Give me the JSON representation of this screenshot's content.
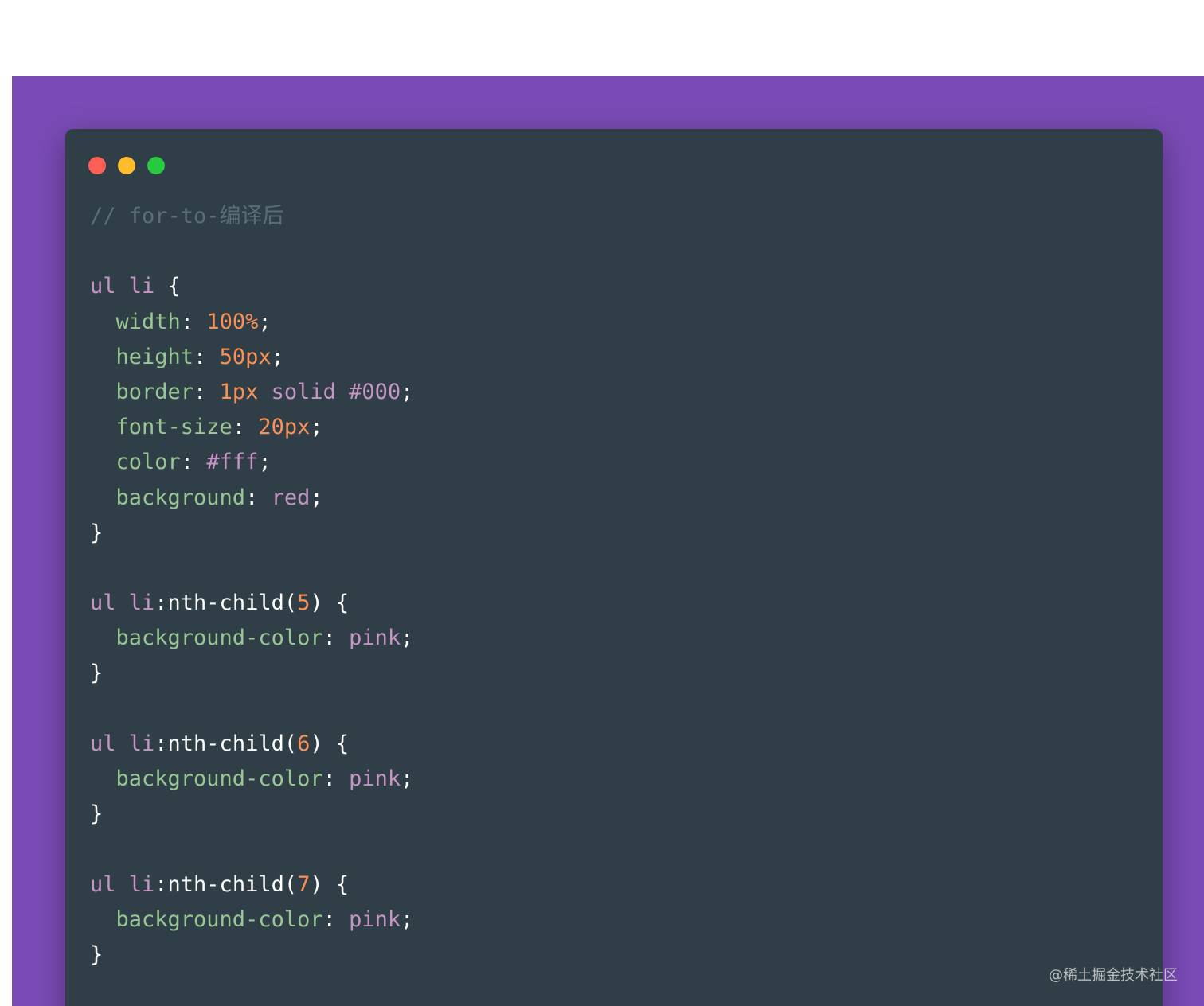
{
  "colors": {
    "background": "#7a4bb6",
    "window": "#2f3e47",
    "comment": "#5d6d75",
    "selector": "#c594c5",
    "property": "#99c794",
    "number": "#f99157",
    "punctuation": "#ffffff"
  },
  "window_controls": [
    {
      "name": "close",
      "color": "#ff5f56"
    },
    {
      "name": "minimize",
      "color": "#ffbd2e"
    },
    {
      "name": "maximize",
      "color": "#27c93f"
    }
  ],
  "code_lines": [
    [
      {
        "t": "// for-to-编译后",
        "c": "comment"
      }
    ],
    [],
    [
      {
        "t": "ul li",
        "c": "selector"
      },
      {
        "t": " {",
        "c": "punct"
      }
    ],
    [
      {
        "t": "  width",
        "c": "property"
      },
      {
        "t": ": ",
        "c": "punct"
      },
      {
        "t": "100%",
        "c": "number"
      },
      {
        "t": ";",
        "c": "punct"
      }
    ],
    [
      {
        "t": "  height",
        "c": "property"
      },
      {
        "t": ": ",
        "c": "punct"
      },
      {
        "t": "50px",
        "c": "number"
      },
      {
        "t": ";",
        "c": "punct"
      }
    ],
    [
      {
        "t": "  border",
        "c": "property"
      },
      {
        "t": ": ",
        "c": "punct"
      },
      {
        "t": "1px",
        "c": "number"
      },
      {
        "t": " solid #000",
        "c": "keyword"
      },
      {
        "t": ";",
        "c": "punct"
      }
    ],
    [
      {
        "t": "  font-size",
        "c": "property"
      },
      {
        "t": ": ",
        "c": "punct"
      },
      {
        "t": "20px",
        "c": "number"
      },
      {
        "t": ";",
        "c": "punct"
      }
    ],
    [
      {
        "t": "  color",
        "c": "property"
      },
      {
        "t": ": ",
        "c": "punct"
      },
      {
        "t": "#fff",
        "c": "keyword"
      },
      {
        "t": ";",
        "c": "punct"
      }
    ],
    [
      {
        "t": "  background",
        "c": "property"
      },
      {
        "t": ": ",
        "c": "punct"
      },
      {
        "t": "red",
        "c": "keyword"
      },
      {
        "t": ";",
        "c": "punct"
      }
    ],
    [
      {
        "t": "}",
        "c": "punct"
      }
    ],
    [],
    [
      {
        "t": "ul li",
        "c": "selector"
      },
      {
        "t": ":nth-child(",
        "c": "pseudo"
      },
      {
        "t": "5",
        "c": "number"
      },
      {
        "t": ") {",
        "c": "punct"
      }
    ],
    [
      {
        "t": "  background-color",
        "c": "property"
      },
      {
        "t": ": ",
        "c": "punct"
      },
      {
        "t": "pink",
        "c": "keyword"
      },
      {
        "t": ";",
        "c": "punct"
      }
    ],
    [
      {
        "t": "}",
        "c": "punct"
      }
    ],
    [],
    [
      {
        "t": "ul li",
        "c": "selector"
      },
      {
        "t": ":nth-child(",
        "c": "pseudo"
      },
      {
        "t": "6",
        "c": "number"
      },
      {
        "t": ") {",
        "c": "punct"
      }
    ],
    [
      {
        "t": "  background-color",
        "c": "property"
      },
      {
        "t": ": ",
        "c": "punct"
      },
      {
        "t": "pink",
        "c": "keyword"
      },
      {
        "t": ";",
        "c": "punct"
      }
    ],
    [
      {
        "t": "}",
        "c": "punct"
      }
    ],
    [],
    [
      {
        "t": "ul li",
        "c": "selector"
      },
      {
        "t": ":nth-child(",
        "c": "pseudo"
      },
      {
        "t": "7",
        "c": "number"
      },
      {
        "t": ") {",
        "c": "punct"
      }
    ],
    [
      {
        "t": "  background-color",
        "c": "property"
      },
      {
        "t": ": ",
        "c": "punct"
      },
      {
        "t": "pink",
        "c": "keyword"
      },
      {
        "t": ";",
        "c": "punct"
      }
    ],
    [
      {
        "t": "}",
        "c": "punct"
      }
    ]
  ],
  "watermark": "@稀土掘金技术社区"
}
